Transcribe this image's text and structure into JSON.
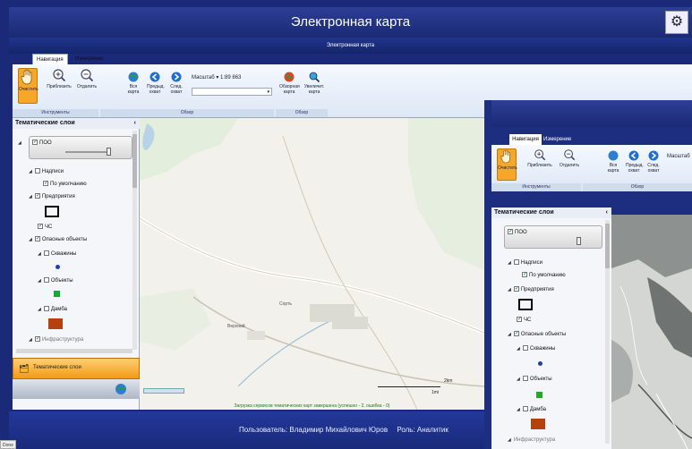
{
  "app": {
    "title": "Электронная карта",
    "subtitle": "Электронная карта",
    "settings_icon": "settings-icon"
  },
  "tabs": [
    {
      "label": "Навигация",
      "active": true
    },
    {
      "label": "Измерение",
      "active": false
    }
  ],
  "ribbon": {
    "tools_group": "Инструменты",
    "view_group": "Обзор",
    "overview_group": "Обзор",
    "buttons": {
      "clear": "Очистить",
      "zoom_in": "Приблизить",
      "zoom_out": "Отдалить",
      "full": "Вся карта",
      "prev": "Предыд. охват",
      "next": "След. охват",
      "overview_map": "Обзорная карта",
      "magnify_map": "Увеличит. карта"
    },
    "scale_label": "Масштаб",
    "scale_value": "1:89 863"
  },
  "layers_panel": {
    "header": "Тематические слои",
    "collapse": "‹",
    "items": [
      {
        "label": "ПОО",
        "checked": true
      },
      {
        "label": "Надписи",
        "checked": false
      },
      {
        "label": "По умолчанию",
        "checked": true
      },
      {
        "label": "Предприятия",
        "checked": true
      },
      {
        "label": "ЧС",
        "checked": true
      },
      {
        "label": "Опасные объекты",
        "checked": true
      },
      {
        "label": "Скважины",
        "checked": false
      },
      {
        "label": "Объекты",
        "checked": false
      },
      {
        "label": "Дамба",
        "checked": false
      },
      {
        "label": "Инфраструктура",
        "checked": false
      }
    ],
    "footer_item": "Тематические слои"
  },
  "map": {
    "scale_bar_km": "2km",
    "scale_bar_mi": "1mi",
    "labels": [
      "Сорть",
      "Верхний"
    ]
  },
  "status": {
    "message": "Загрузка сервисов тематических карт завершена (успешно - 2, ошибка - 0)"
  },
  "footer": {
    "user_label": "Пользователь: Владимир Михайлович Юров",
    "role_label": "Роль: Аналитик"
  },
  "browser_status": "Done",
  "colors": {
    "header": "#1b2a78",
    "highlight": "#f6a72a",
    "wells": "#1f3fb0",
    "objects": "#22aa22",
    "dam": "#b5410e"
  }
}
